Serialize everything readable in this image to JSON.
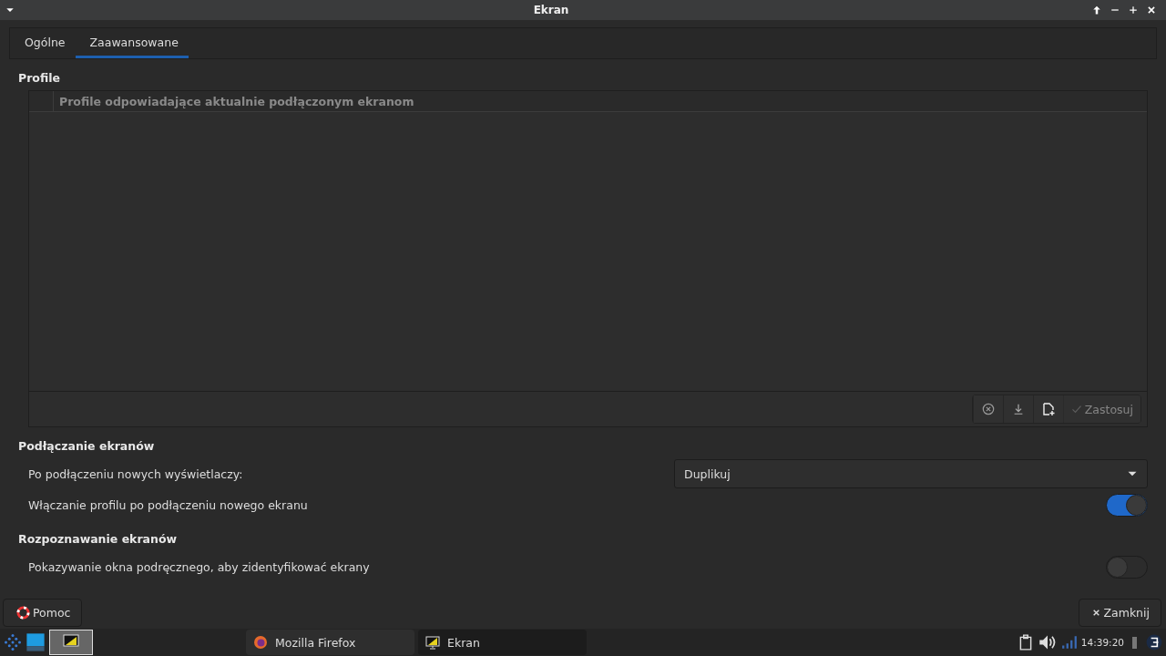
{
  "window": {
    "title": "Ekran"
  },
  "tabs": [
    {
      "label": "Ogólne",
      "selected": false
    },
    {
      "label": "Zaawansowane",
      "selected": true
    }
  ],
  "profiles": {
    "heading": "Profile",
    "column": "Profile odpowiadające aktualnie podłączonym ekranom",
    "actions": [
      {
        "kind": "remove",
        "disabled": false
      },
      {
        "kind": "download",
        "disabled": false
      },
      {
        "kind": "new",
        "disabled": false
      },
      {
        "kind": "apply",
        "label": "Zastosuj",
        "disabled": true
      }
    ]
  },
  "sections": [
    {
      "heading": "Podłączanie ekranów",
      "rows": [
        {
          "kind": "dropdown",
          "label": "Po podłączeniu nowych wyświetlaczy:",
          "value": "Duplikuj"
        },
        {
          "kind": "switch",
          "label": "Włączanie profilu po podłączeniu nowego ekranu",
          "on": true
        }
      ]
    },
    {
      "heading": "Rozpoznawanie ekranów",
      "rows": [
        {
          "kind": "switch",
          "label": "Pokazywanie okna podręcznego, aby zidentyfikować ekrany",
          "on": false
        }
      ]
    }
  ],
  "footer": {
    "help": "Pomoc",
    "close": "Zamknij"
  },
  "taskbar": {
    "windows": [
      {
        "title": "Mozilla Firefox",
        "kind": "firefox",
        "selected": false
      },
      {
        "title": "Ekran",
        "kind": "display",
        "selected": true
      }
    ],
    "clock": "14:39:20"
  }
}
